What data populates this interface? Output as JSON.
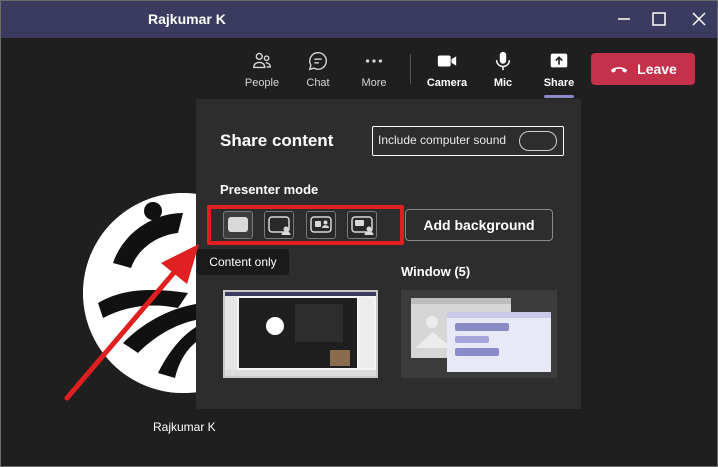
{
  "window": {
    "title": "Rajkumar K",
    "controls": [
      "minimize-icon",
      "maximize-icon",
      "close-icon"
    ]
  },
  "toolbar": {
    "people_label": "People",
    "chat_label": "Chat",
    "more_label": "More",
    "camera_label": "Camera",
    "mic_label": "Mic",
    "share_label": "Share",
    "leave_label": "Leave"
  },
  "participant": {
    "name": "Rajkumar K"
  },
  "share_panel": {
    "title": "Share content",
    "include_sound_label": "Include computer sound",
    "include_sound_on": false,
    "presenter_mode_label": "Presenter mode",
    "presenter_modes": [
      "content-only-icon",
      "standout-icon",
      "side-by-side-icon",
      "reporter-icon"
    ],
    "selected_mode_tooltip": "Content only",
    "add_background_label": "Add background",
    "window_label": "Window (5)"
  },
  "colors": {
    "titlebar": "#3a3b5e",
    "leave": "#c4314b",
    "accent": "#8b8cc7",
    "annotation": "#e02020",
    "panel": "#2d2d2d"
  }
}
